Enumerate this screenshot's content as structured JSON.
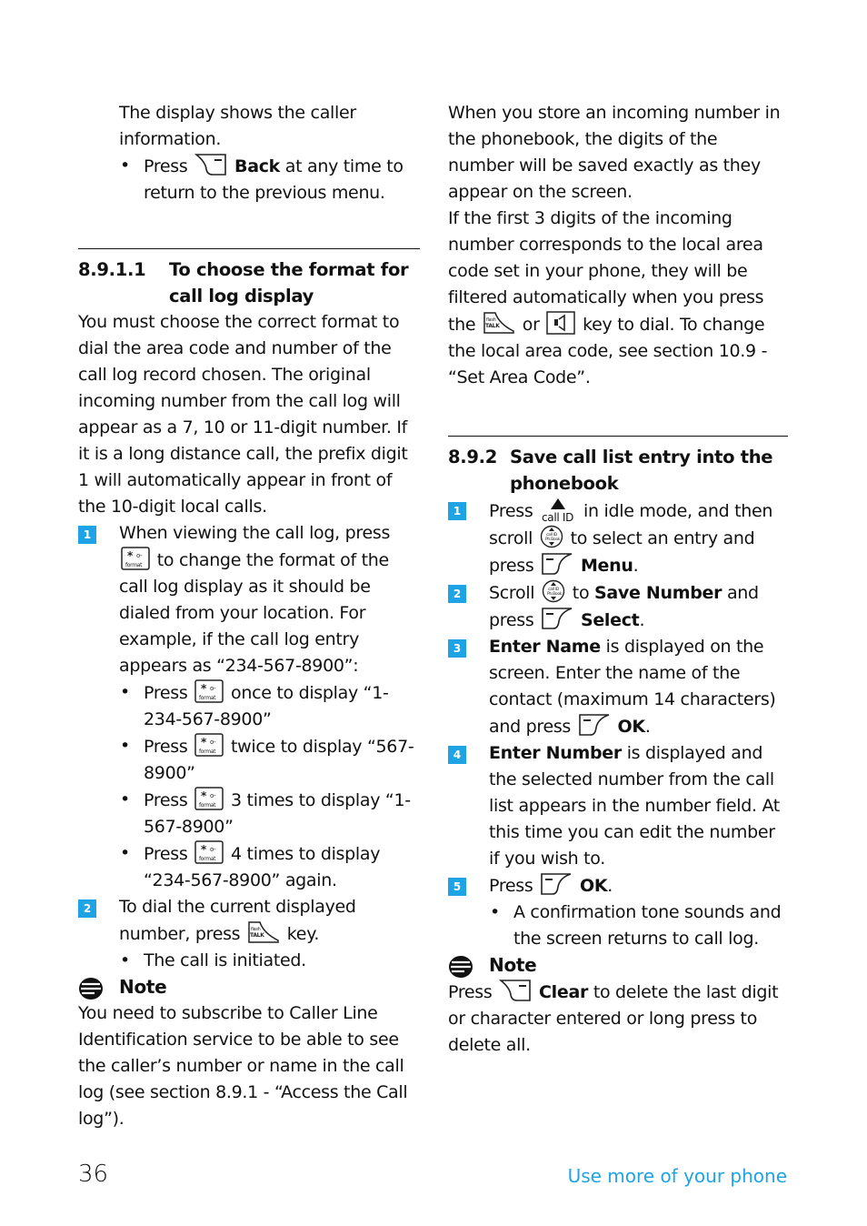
{
  "left": {
    "intro": "The display shows the caller information.",
    "back_bullet": {
      "pre": "Press",
      "key": "back-softkey",
      "bold": "Back",
      "post": "at any time to return to the previous menu."
    },
    "section": {
      "number": "8.9.1.1",
      "title": "To choose the format for call log display"
    },
    "body": "You must choose the correct format to dial the area code and number of the call log record chosen. The original incoming number from the call log will appear as a 7, 10 or 11-digit number. If it is a long distance call, the prefix digit 1 will automatically appear in front of the 10-digit local calls.",
    "step1": {
      "num": "1",
      "pre": "When viewing the call log, press",
      "post": "to change the format of the call log display as it should be dialed from your location. For example, if the call log entry appears as “234-567-8900”:"
    },
    "format_bullets": [
      {
        "pre": "Press",
        "post": "once to display “1-234-567-8900”"
      },
      {
        "pre": "Press",
        "post": "twice to display “567-8900”"
      },
      {
        "pre": "Press",
        "post": "3 times to display “1-567-8900”"
      },
      {
        "pre": "Press",
        "post": "4 times to display “234-567-8900” again."
      }
    ],
    "step2": {
      "num": "2",
      "pre": "To dial the current displayed number, press",
      "post": "key."
    },
    "step2_bullet": "The call is initiated.",
    "note_label": "Note",
    "note_text": "You need to subscribe to Caller Line Identification service to be able to see the caller’s number or name in the call log (see section 8.9.1 - “Access the Call log”)."
  },
  "right": {
    "para1": "When you store an incoming number in the phonebook, the digits of the number will be saved exactly as they appear on the screen.",
    "para2_pre": "If the first 3 digits of the incoming number corresponds to the local area code set in your phone, they will be filtered automatically when you press the",
    "para2_or": "or",
    "para2_post": "key to dial. To change the local area code, see section 10.9 - “Set Area Code”.",
    "section": {
      "number": "8.9.2",
      "title": "Save call list entry into the phonebook"
    },
    "steps": [
      {
        "num": "1",
        "t1": "Press",
        "t2": "in idle mode, and then scroll",
        "t3": "to select an entry and press",
        "bold": "Menu",
        "end": "."
      },
      {
        "num": "2",
        "t1": "Scroll",
        "t2": "to",
        "bold1": "Save Number",
        "t3": "and press",
        "bold2": "Select",
        "end": "."
      },
      {
        "num": "3",
        "bold": "Enter Name",
        "t1": "is displayed on the screen. Enter the name of the contact (maximum 14 characters) and press",
        "bold2": "OK",
        "end": "."
      },
      {
        "num": "4",
        "bold": "Enter Number",
        "t1": "is displayed and the selected number from the call list appears in the number field. At this time you can edit the number if you wish to."
      },
      {
        "num": "5",
        "t1": "Press",
        "bold": "OK",
        "end": "."
      }
    ],
    "step5_bullet": "A confirmation tone sounds and the screen returns to call log.",
    "note_label": "Note",
    "note_pre": "Press",
    "note_bold": "Clear",
    "note_post": "to delete the last digit or character entered or long press to delete all."
  },
  "footer": {
    "page_number": "36",
    "chapter": "Use more of your phone"
  },
  "colors": {
    "accent": "#1ea4e4",
    "text": "#111111"
  }
}
